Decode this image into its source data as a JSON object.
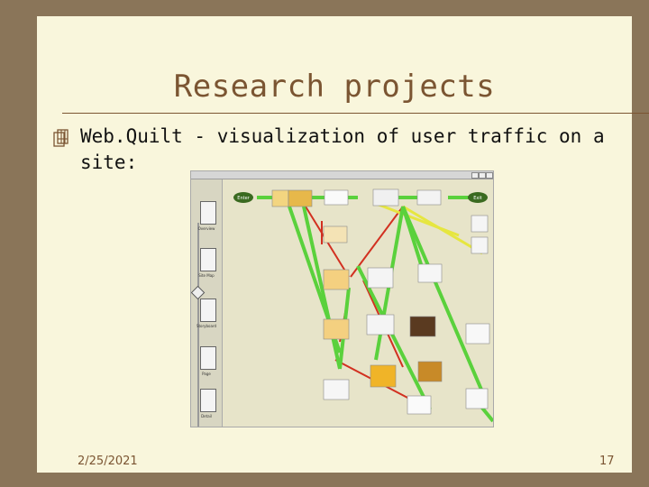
{
  "title": "Research projects",
  "bullet": "Web.Quilt - visualization of user traffic on a site:",
  "footer": {
    "date": "2/25/2021",
    "page": "17"
  },
  "screenshot": {
    "start_label": "Enter",
    "end_label": "Exit",
    "tools": [
      "Overview",
      "Site Map",
      "Storyboard",
      "Page",
      "Detail"
    ]
  },
  "colors": {
    "heavy_traffic": "#5ad13c",
    "light_traffic": "#e6e640",
    "back_traffic": "#d23020"
  }
}
